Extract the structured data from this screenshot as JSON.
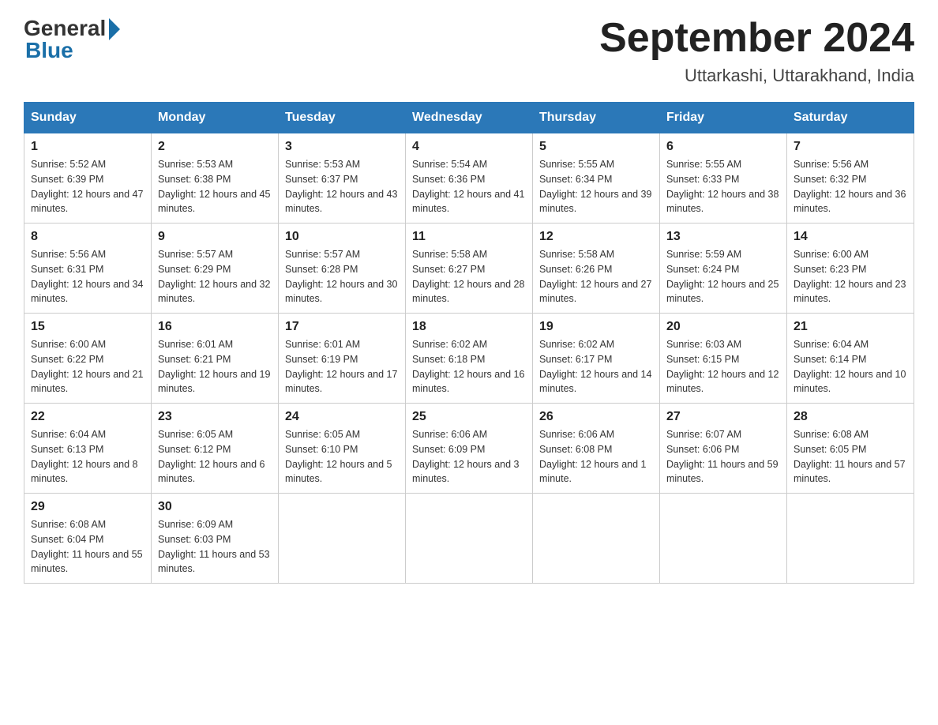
{
  "header": {
    "logo_general": "General",
    "logo_blue": "Blue",
    "month_title": "September 2024",
    "location": "Uttarkashi, Uttarakhand, India"
  },
  "weekdays": [
    "Sunday",
    "Monday",
    "Tuesday",
    "Wednesday",
    "Thursday",
    "Friday",
    "Saturday"
  ],
  "weeks": [
    [
      {
        "day": "1",
        "sunrise": "5:52 AM",
        "sunset": "6:39 PM",
        "daylight": "12 hours and 47 minutes."
      },
      {
        "day": "2",
        "sunrise": "5:53 AM",
        "sunset": "6:38 PM",
        "daylight": "12 hours and 45 minutes."
      },
      {
        "day": "3",
        "sunrise": "5:53 AM",
        "sunset": "6:37 PM",
        "daylight": "12 hours and 43 minutes."
      },
      {
        "day": "4",
        "sunrise": "5:54 AM",
        "sunset": "6:36 PM",
        "daylight": "12 hours and 41 minutes."
      },
      {
        "day": "5",
        "sunrise": "5:55 AM",
        "sunset": "6:34 PM",
        "daylight": "12 hours and 39 minutes."
      },
      {
        "day": "6",
        "sunrise": "5:55 AM",
        "sunset": "6:33 PM",
        "daylight": "12 hours and 38 minutes."
      },
      {
        "day": "7",
        "sunrise": "5:56 AM",
        "sunset": "6:32 PM",
        "daylight": "12 hours and 36 minutes."
      }
    ],
    [
      {
        "day": "8",
        "sunrise": "5:56 AM",
        "sunset": "6:31 PM",
        "daylight": "12 hours and 34 minutes."
      },
      {
        "day": "9",
        "sunrise": "5:57 AM",
        "sunset": "6:29 PM",
        "daylight": "12 hours and 32 minutes."
      },
      {
        "day": "10",
        "sunrise": "5:57 AM",
        "sunset": "6:28 PM",
        "daylight": "12 hours and 30 minutes."
      },
      {
        "day": "11",
        "sunrise": "5:58 AM",
        "sunset": "6:27 PM",
        "daylight": "12 hours and 28 minutes."
      },
      {
        "day": "12",
        "sunrise": "5:58 AM",
        "sunset": "6:26 PM",
        "daylight": "12 hours and 27 minutes."
      },
      {
        "day": "13",
        "sunrise": "5:59 AM",
        "sunset": "6:24 PM",
        "daylight": "12 hours and 25 minutes."
      },
      {
        "day": "14",
        "sunrise": "6:00 AM",
        "sunset": "6:23 PM",
        "daylight": "12 hours and 23 minutes."
      }
    ],
    [
      {
        "day": "15",
        "sunrise": "6:00 AM",
        "sunset": "6:22 PM",
        "daylight": "12 hours and 21 minutes."
      },
      {
        "day": "16",
        "sunrise": "6:01 AM",
        "sunset": "6:21 PM",
        "daylight": "12 hours and 19 minutes."
      },
      {
        "day": "17",
        "sunrise": "6:01 AM",
        "sunset": "6:19 PM",
        "daylight": "12 hours and 17 minutes."
      },
      {
        "day": "18",
        "sunrise": "6:02 AM",
        "sunset": "6:18 PM",
        "daylight": "12 hours and 16 minutes."
      },
      {
        "day": "19",
        "sunrise": "6:02 AM",
        "sunset": "6:17 PM",
        "daylight": "12 hours and 14 minutes."
      },
      {
        "day": "20",
        "sunrise": "6:03 AM",
        "sunset": "6:15 PM",
        "daylight": "12 hours and 12 minutes."
      },
      {
        "day": "21",
        "sunrise": "6:04 AM",
        "sunset": "6:14 PM",
        "daylight": "12 hours and 10 minutes."
      }
    ],
    [
      {
        "day": "22",
        "sunrise": "6:04 AM",
        "sunset": "6:13 PM",
        "daylight": "12 hours and 8 minutes."
      },
      {
        "day": "23",
        "sunrise": "6:05 AM",
        "sunset": "6:12 PM",
        "daylight": "12 hours and 6 minutes."
      },
      {
        "day": "24",
        "sunrise": "6:05 AM",
        "sunset": "6:10 PM",
        "daylight": "12 hours and 5 minutes."
      },
      {
        "day": "25",
        "sunrise": "6:06 AM",
        "sunset": "6:09 PM",
        "daylight": "12 hours and 3 minutes."
      },
      {
        "day": "26",
        "sunrise": "6:06 AM",
        "sunset": "6:08 PM",
        "daylight": "12 hours and 1 minute."
      },
      {
        "day": "27",
        "sunrise": "6:07 AM",
        "sunset": "6:06 PM",
        "daylight": "11 hours and 59 minutes."
      },
      {
        "day": "28",
        "sunrise": "6:08 AM",
        "sunset": "6:05 PM",
        "daylight": "11 hours and 57 minutes."
      }
    ],
    [
      {
        "day": "29",
        "sunrise": "6:08 AM",
        "sunset": "6:04 PM",
        "daylight": "11 hours and 55 minutes."
      },
      {
        "day": "30",
        "sunrise": "6:09 AM",
        "sunset": "6:03 PM",
        "daylight": "11 hours and 53 minutes."
      },
      null,
      null,
      null,
      null,
      null
    ]
  ]
}
